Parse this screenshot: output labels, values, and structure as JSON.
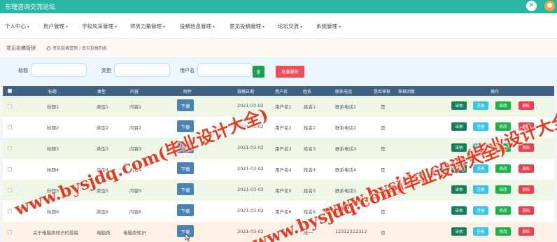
{
  "app": {
    "title": "东理咨询交流论坛"
  },
  "topbar": {
    "close_glyph": "✕",
    "user_glyph": "●"
  },
  "nav": {
    "items": [
      "个人中心",
      "用户管理",
      "学校风采管理",
      "师资力量管理",
      "投稿信息管理",
      "意见投稿管理",
      "论坛交流",
      "系统管理"
    ],
    "caret": "▾"
  },
  "page": {
    "title": "意见投稿管理",
    "breadcrumb": [
      "意见投稿管理",
      "意见投稿列表"
    ],
    "breadcrumb_separator": "/"
  },
  "search": {
    "fields": [
      {
        "label": "标题",
        "value": "",
        "placeholder": ""
      },
      {
        "label": "类型",
        "value": "",
        "placeholder": ""
      },
      {
        "label": "用户名",
        "value": "",
        "placeholder": ""
      }
    ],
    "search_button": "查",
    "batch_delete_button": "批量删除"
  },
  "table": {
    "columns": [
      "标题",
      "类型",
      "内容",
      "附件",
      "投稿日期",
      "用户名",
      "姓名",
      "联系电话",
      "是否审核",
      "审核回复",
      "操作"
    ],
    "download_label": "下载",
    "actions": {
      "review": "审核",
      "view": "查看",
      "edit": "修改",
      "delete": "删除"
    },
    "rows": [
      {
        "title": "标题1",
        "type": "类型1",
        "content": "内容1",
        "date": "2021-03-02",
        "username": "用户名1",
        "name": "姓名1",
        "phone": "联系电话1",
        "reviewed": "是",
        "reply": ""
      },
      {
        "title": "标题2",
        "type": "类型2",
        "content": "内容2",
        "date": "2021-03-02",
        "username": "用户名2",
        "name": "姓名2",
        "phone": "联系电话2",
        "reviewed": "是",
        "reply": ""
      },
      {
        "title": "标题3",
        "type": "类型3",
        "content": "内容3",
        "date": "2021-03-02",
        "username": "用户名3",
        "name": "姓名3",
        "phone": "联系电话3",
        "reviewed": "是",
        "reply": ""
      },
      {
        "title": "标题4",
        "type": "类型4",
        "content": "内容4",
        "date": "2021-03-02",
        "username": "用户名4",
        "name": "姓名4",
        "phone": "联系电话4",
        "reviewed": "是",
        "reply": ""
      },
      {
        "title": "标题5",
        "type": "类型5",
        "content": "内容5",
        "date": "2021-03-02",
        "username": "用户名5",
        "name": "姓名5",
        "phone": "联系电话5",
        "reviewed": "是",
        "reply": ""
      },
      {
        "title": "标题6",
        "type": "类型6",
        "content": "内容6",
        "date": "2021-03-02",
        "username": "用户名6",
        "name": "姓名6",
        "phone": "联系电话6",
        "reviewed": "是",
        "reply": ""
      },
      {
        "title": "关于电脑类知识的投稿",
        "type": "电脑类",
        "content": "电脑类知识",
        "date": "2021-03-02",
        "username": "",
        "name": "陈一",
        "phone": "12312312312",
        "reviewed": "否",
        "reply": ""
      }
    ]
  },
  "watermark": {
    "text": "www.bysjdq.com(毕业设计大全)",
    "color": "#e63a1e"
  },
  "colors": {
    "topbar": "#29b5a6",
    "table_header": "#3f6283",
    "download": "#4a82b3",
    "review": "#167e5b",
    "view": "#36c4e8",
    "edit": "#1ab34c",
    "delete": "#ef3d4e"
  }
}
